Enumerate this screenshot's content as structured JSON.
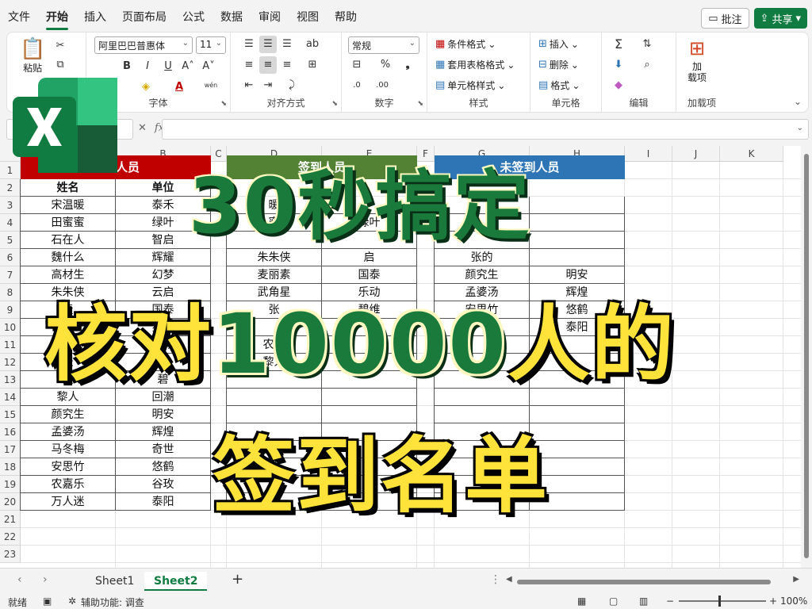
{
  "menu": {
    "items": [
      "文件",
      "开始",
      "插入",
      "页面布局",
      "公式",
      "数据",
      "审阅",
      "视图",
      "帮助"
    ],
    "active_index": 1
  },
  "top_right": {
    "comment": "批注",
    "share": "共享"
  },
  "ribbon": {
    "clipboard": {
      "label": "粘贴"
    },
    "font": {
      "name": "阿里巴巴普惠体",
      "size": "11",
      "label": "字体",
      "bold": "B",
      "italic": "I",
      "underline": "U",
      "grow": "A˄",
      "shrink": "A˅",
      "phonetic": "wén"
    },
    "alignment": {
      "label": "对齐方式"
    },
    "number": {
      "format": "常规",
      "label": "数字",
      "percent": "%",
      "comma": "❟"
    },
    "styles": {
      "cond": "条件格式",
      "table": "套用表格格式",
      "cell": "单元格样式",
      "label": "样式"
    },
    "cells": {
      "insert": "插入",
      "delete": "删除",
      "format": "格式",
      "label": "单元格"
    },
    "editing": {
      "label": "编辑"
    },
    "addins": {
      "button": "加\n载项",
      "label": "加载项"
    }
  },
  "formula_bar": {
    "fx": "fx"
  },
  "grid": {
    "columns": [
      "A",
      "B",
      "C",
      "D",
      "E",
      "F",
      "G",
      "H",
      "I",
      "J",
      "K"
    ],
    "rows": [
      "1",
      "2",
      "3",
      "4",
      "5",
      "6",
      "7",
      "8",
      "9",
      "10",
      "11",
      "12",
      "13",
      "14",
      "15",
      "16",
      "17",
      "18",
      "19",
      "20",
      "21",
      "22",
      "23"
    ],
    "band_attendees": "参会人员",
    "band_signed": "签到人员",
    "band_unsigned": "未签到人员",
    "hdr_name": "姓名",
    "hdr_unit": "单位",
    "table_a": [
      [
        "宋温暖",
        "泰禾"
      ],
      [
        "田蜜蜜",
        "绿叶"
      ],
      [
        "石在人",
        "智启"
      ],
      [
        "魏什么",
        "辉耀"
      ],
      [
        "高材生",
        "幻梦"
      ],
      [
        "朱朱侠",
        "云启"
      ],
      [
        "麦",
        "国泰"
      ],
      [
        "赵",
        "星辉"
      ],
      [
        "武",
        "乐动"
      ],
      [
        "张",
        "光"
      ],
      [
        "张",
        "碧"
      ],
      [
        "黎人",
        "回潮"
      ],
      [
        "颜究生",
        "明安"
      ],
      [
        "孟婆汤",
        "辉煌"
      ],
      [
        "马冬梅",
        "奇世"
      ],
      [
        "安思竹",
        "悠鹤"
      ],
      [
        "农嘉乐",
        "谷玫"
      ],
      [
        "万人迷",
        "泰阳"
      ]
    ],
    "table_d": [
      [
        "暖",
        ""
      ],
      [
        "蜜",
        "绿叶"
      ],
      [
        "",
        ""
      ],
      [
        "朱朱侠",
        "启"
      ],
      [
        "麦丽素",
        "国泰"
      ],
      [
        "武角星",
        "乐动"
      ],
      [
        "张",
        "碧维"
      ],
      [
        "",
        ""
      ],
      [
        "农嘉",
        ""
      ],
      [
        "黎人",
        ""
      ]
    ],
    "table_g": [
      [
        "",
        ""
      ],
      [
        "",
        ""
      ],
      [
        "",
        ""
      ],
      [
        "张的",
        ""
      ],
      [
        "颜究生",
        "明安"
      ],
      [
        "孟婆汤",
        "辉煌"
      ],
      [
        "安思竹",
        "悠鹤"
      ],
      [
        "",
        "泰阳"
      ]
    ]
  },
  "overlay": {
    "line1": "30秒搞定",
    "line2_a": "核对",
    "line2_b": "10000",
    "line2_c": "人的",
    "line3": "签到名单"
  },
  "sheets": {
    "tabs": [
      "Sheet1",
      "Sheet2"
    ],
    "active_index": 1,
    "add": "+"
  },
  "status": {
    "ready": "就绪",
    "accessibility": "辅助功能: 调查",
    "zoom": "100%"
  },
  "colors": {
    "brand": "#107c41",
    "red_band": "#c00000",
    "green_band": "#548235",
    "blue_band": "#2e75b6",
    "yellow": "#ffe33a"
  }
}
